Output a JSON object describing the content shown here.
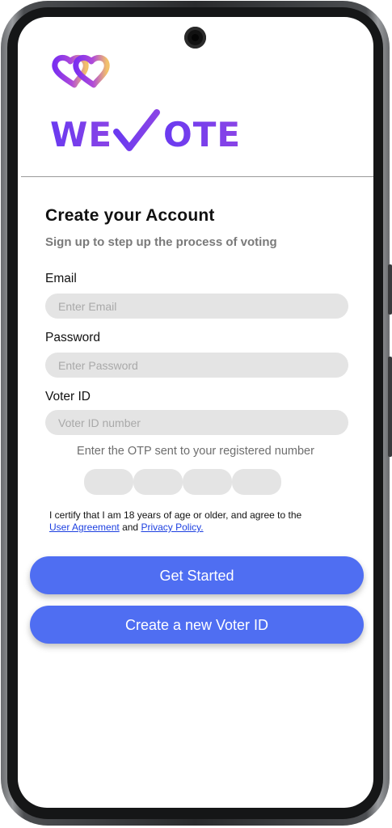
{
  "brand": {
    "name": "WE✓OTE",
    "logo_icon": "linked-hearts-icon",
    "accent": "#7b3fe4"
  },
  "header": {
    "title": "Create your Account",
    "subtitle": "Sign up to step up the process of voting"
  },
  "form": {
    "email": {
      "label": "Email",
      "placeholder": "Enter Email",
      "value": ""
    },
    "password": {
      "label": "Password",
      "placeholder": "Enter Password",
      "value": ""
    },
    "voter_id": {
      "label": "Voter ID",
      "placeholder": "Voter ID number",
      "value": ""
    },
    "otp": {
      "prompt": "Enter the OTP sent to your registered number",
      "digits": [
        "",
        "",
        "",
        ""
      ]
    }
  },
  "consent": {
    "text_before": "I certify that I am 18 years of age or older, and agree to the",
    "link_agreement": "User Agreement",
    "text_and": "and",
    "link_privacy": "Privacy Policy."
  },
  "actions": {
    "primary_label": "Get Started",
    "secondary_label": "Create a new Voter ID",
    "button_color": "#4f6ef2"
  }
}
